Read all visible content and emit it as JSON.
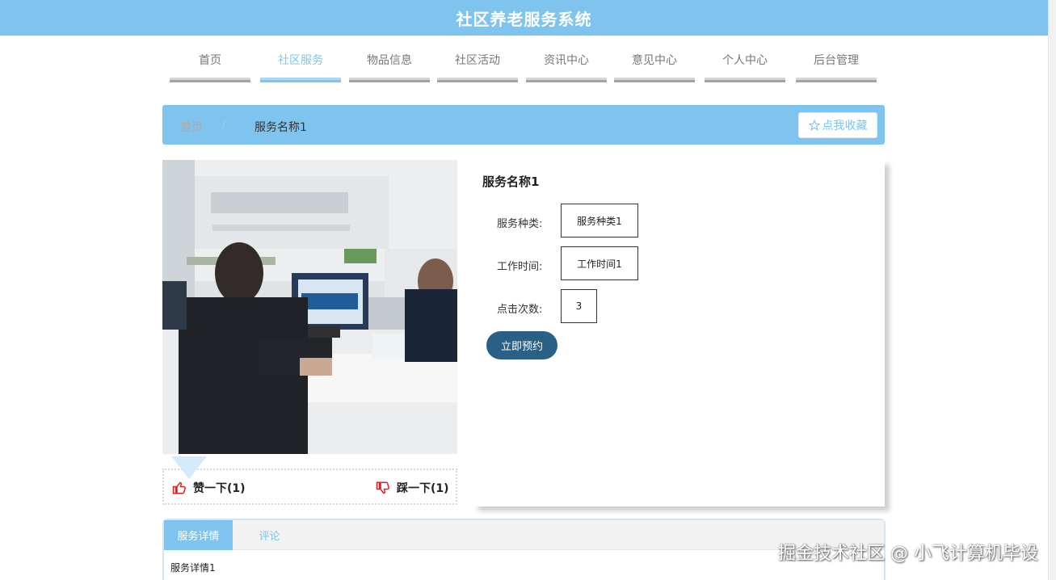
{
  "header": {
    "title": "社区养老服务系统"
  },
  "nav": {
    "items": [
      {
        "label": "首页",
        "active": false
      },
      {
        "label": "社区服务",
        "active": true
      },
      {
        "label": "物品信息",
        "active": false
      },
      {
        "label": "社区活动",
        "active": false
      },
      {
        "label": "资讯中心",
        "active": false
      },
      {
        "label": "意见中心",
        "active": false
      },
      {
        "label": "个人中心",
        "active": false
      },
      {
        "label": "后台管理",
        "active": false
      }
    ]
  },
  "breadcrumb": {
    "home": "首页",
    "separator": "/",
    "current": "服务名称1",
    "favorite_label": "点我收藏"
  },
  "votes": {
    "like_label": "赞一下(1)",
    "dislike_label": "踩一下(1)"
  },
  "service": {
    "name": "服务名称1",
    "fields": [
      {
        "label": "服务种类:",
        "value": "服务种类1"
      },
      {
        "label": "工作时间:",
        "value": "工作时间1"
      },
      {
        "label": "点击次数:",
        "value": "3"
      }
    ],
    "book_label": "立即预约"
  },
  "detail": {
    "tabs": [
      "服务详情",
      "评论"
    ],
    "content": "服务详情1"
  },
  "watermark": "掘金技术社区 @ 小飞计算机毕设",
  "colors": {
    "primary": "#7fc4ef",
    "button": "#2a5f86",
    "thumb": "#e02020"
  }
}
